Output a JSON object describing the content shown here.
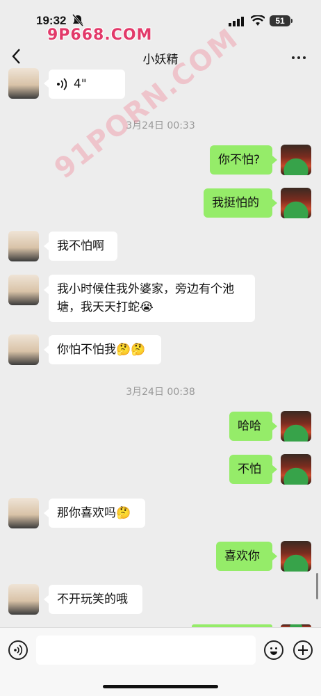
{
  "status_bar": {
    "time": "19:32",
    "battery": "51",
    "watermark": "9P668.COM"
  },
  "watermark_diag": "91PORN.COM",
  "header": {
    "title": "小妖精"
  },
  "messages": [
    {
      "side": "left",
      "type": "voice",
      "duration": "4\""
    },
    {
      "side": "time",
      "text": "3月24日 00:33"
    },
    {
      "side": "right",
      "text": "你不怕?"
    },
    {
      "side": "right",
      "text": "我挺怕的"
    },
    {
      "side": "left",
      "text": "我不怕啊"
    },
    {
      "side": "left",
      "lines": [
        "我小时候住我外婆家，旁边有个池",
        "塘，我天天打蛇😭"
      ]
    },
    {
      "side": "left",
      "text": "你怕不怕我🤔🤔"
    },
    {
      "side": "time",
      "text": "3月24日 00:38"
    },
    {
      "side": "right",
      "text": "哈哈"
    },
    {
      "side": "right",
      "text": "不怕"
    },
    {
      "side": "left",
      "text": "那你喜欢吗🤔"
    },
    {
      "side": "right",
      "text": "喜欢你"
    },
    {
      "side": "left",
      "text": "不开玩笑的哦"
    }
  ],
  "icons": [
    "back-chevron-icon",
    "more-icon",
    "voice-icon",
    "emoji-icon",
    "plus-icon",
    "wifi-icon",
    "signal-icon",
    "bell-slash-icon"
  ]
}
